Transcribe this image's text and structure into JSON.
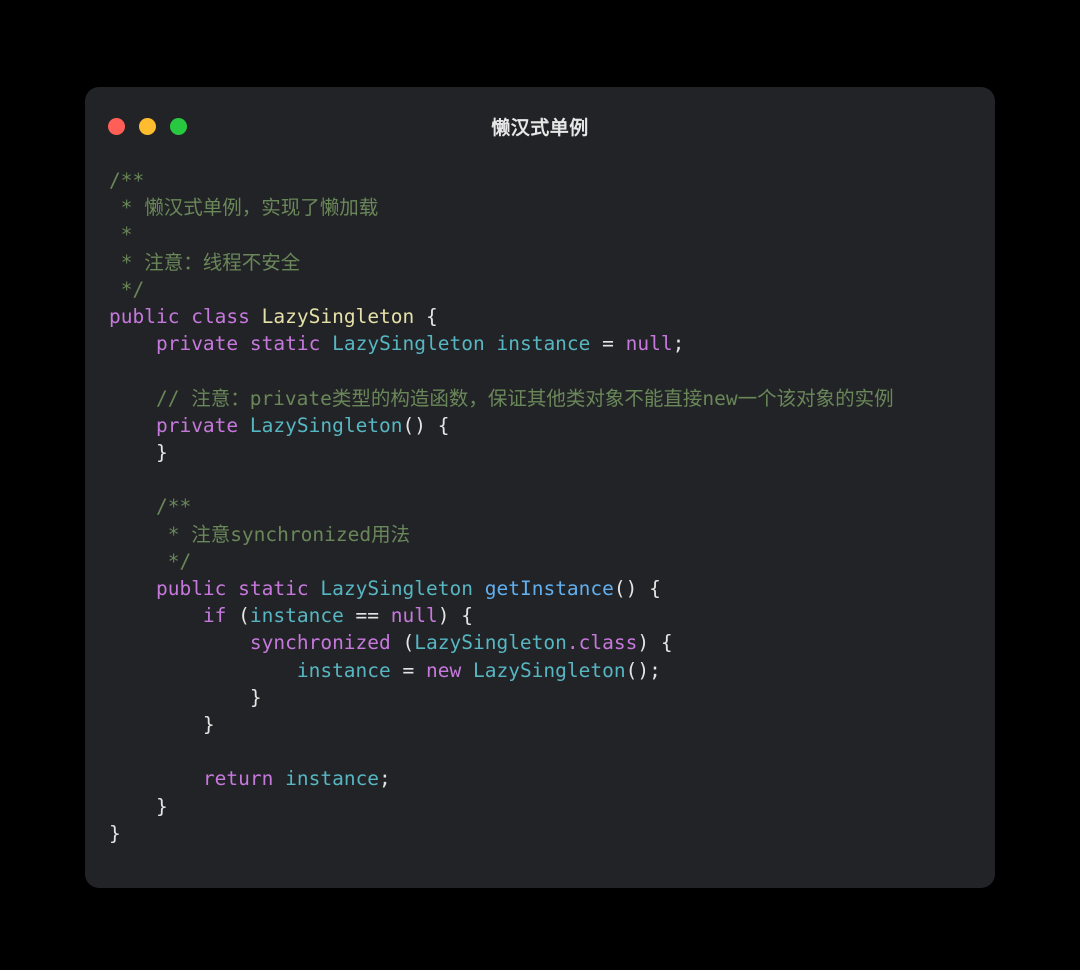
{
  "window": {
    "title": "懒汉式单例",
    "controls": [
      {
        "name": "close",
        "color": "#ff5f57"
      },
      {
        "name": "minimize",
        "color": "#febc2e"
      },
      {
        "name": "maximize",
        "color": "#28c840"
      }
    ]
  },
  "theme": {
    "page_background": "#000000",
    "card_background": "#222326",
    "default_text": "#e4e4e4",
    "comment": "#6a8759",
    "keyword": "#c678dd",
    "type": "#56b6c2",
    "class_declaration": "#e5e0a8",
    "function": "#61afef"
  },
  "code": {
    "language": "java",
    "lines": [
      [
        {
          "t": "/**",
          "c": "comment"
        }
      ],
      [
        {
          "t": " * 懒汉式单例，实现了懒加载",
          "c": "comment"
        }
      ],
      [
        {
          "t": " *",
          "c": "comment"
        }
      ],
      [
        {
          "t": " * 注意：线程不安全",
          "c": "comment"
        }
      ],
      [
        {
          "t": " */",
          "c": "comment"
        }
      ],
      [
        {
          "t": "public",
          "c": "keyword"
        },
        {
          "t": " ",
          "c": "punct"
        },
        {
          "t": "class",
          "c": "keyword"
        },
        {
          "t": " ",
          "c": "punct"
        },
        {
          "t": "LazySingleton",
          "c": "class"
        },
        {
          "t": " {",
          "c": "punct"
        }
      ],
      [
        {
          "t": "    ",
          "c": "punct"
        },
        {
          "t": "private",
          "c": "keyword"
        },
        {
          "t": " ",
          "c": "punct"
        },
        {
          "t": "static",
          "c": "keyword"
        },
        {
          "t": " ",
          "c": "punct"
        },
        {
          "t": "LazySingleton",
          "c": "type"
        },
        {
          "t": " ",
          "c": "punct"
        },
        {
          "t": "instance",
          "c": "ident"
        },
        {
          "t": " = ",
          "c": "op"
        },
        {
          "t": "null",
          "c": "keyword"
        },
        {
          "t": ";",
          "c": "punct"
        }
      ],
      [
        {
          "t": "",
          "c": "punct"
        }
      ],
      [
        {
          "t": "    ",
          "c": "punct"
        },
        {
          "t": "// 注意：private类型的构造函数，保证其他类对象不能直接new一个该对象的实例",
          "c": "comment"
        }
      ],
      [
        {
          "t": "    ",
          "c": "punct"
        },
        {
          "t": "private",
          "c": "keyword"
        },
        {
          "t": " ",
          "c": "punct"
        },
        {
          "t": "LazySingleton",
          "c": "type"
        },
        {
          "t": "() {",
          "c": "punct"
        }
      ],
      [
        {
          "t": "    }",
          "c": "punct"
        }
      ],
      [
        {
          "t": "",
          "c": "punct"
        }
      ],
      [
        {
          "t": "    ",
          "c": "punct"
        },
        {
          "t": "/**",
          "c": "comment"
        }
      ],
      [
        {
          "t": "    ",
          "c": "punct"
        },
        {
          "t": " * 注意synchronized用法",
          "c": "comment"
        }
      ],
      [
        {
          "t": "    ",
          "c": "punct"
        },
        {
          "t": " */",
          "c": "comment"
        }
      ],
      [
        {
          "t": "    ",
          "c": "punct"
        },
        {
          "t": "public",
          "c": "keyword"
        },
        {
          "t": " ",
          "c": "punct"
        },
        {
          "t": "static",
          "c": "keyword"
        },
        {
          "t": " ",
          "c": "punct"
        },
        {
          "t": "LazySingleton",
          "c": "type"
        },
        {
          "t": " ",
          "c": "punct"
        },
        {
          "t": "getInstance",
          "c": "func"
        },
        {
          "t": "() {",
          "c": "punct"
        }
      ],
      [
        {
          "t": "        ",
          "c": "punct"
        },
        {
          "t": "if",
          "c": "keyword"
        },
        {
          "t": " (",
          "c": "punct"
        },
        {
          "t": "instance",
          "c": "ident"
        },
        {
          "t": " == ",
          "c": "op"
        },
        {
          "t": "null",
          "c": "keyword"
        },
        {
          "t": ") {",
          "c": "punct"
        }
      ],
      [
        {
          "t": "            ",
          "c": "punct"
        },
        {
          "t": "synchronized",
          "c": "keyword"
        },
        {
          "t": " (",
          "c": "punct"
        },
        {
          "t": "LazySingleton",
          "c": "type"
        },
        {
          "t": ".class",
          "c": "keyword"
        },
        {
          "t": ") {",
          "c": "punct"
        }
      ],
      [
        {
          "t": "                ",
          "c": "punct"
        },
        {
          "t": "instance",
          "c": "ident"
        },
        {
          "t": " = ",
          "c": "op"
        },
        {
          "t": "new",
          "c": "keyword"
        },
        {
          "t": " ",
          "c": "punct"
        },
        {
          "t": "LazySingleton",
          "c": "type"
        },
        {
          "t": "();",
          "c": "punct"
        }
      ],
      [
        {
          "t": "            }",
          "c": "punct"
        }
      ],
      [
        {
          "t": "        }",
          "c": "punct"
        }
      ],
      [
        {
          "t": "",
          "c": "punct"
        }
      ],
      [
        {
          "t": "        ",
          "c": "punct"
        },
        {
          "t": "return",
          "c": "keyword"
        },
        {
          "t": " ",
          "c": "punct"
        },
        {
          "t": "instance",
          "c": "ident"
        },
        {
          "t": ";",
          "c": "punct"
        }
      ],
      [
        {
          "t": "    }",
          "c": "punct"
        }
      ],
      [
        {
          "t": "}",
          "c": "punct"
        }
      ]
    ]
  }
}
